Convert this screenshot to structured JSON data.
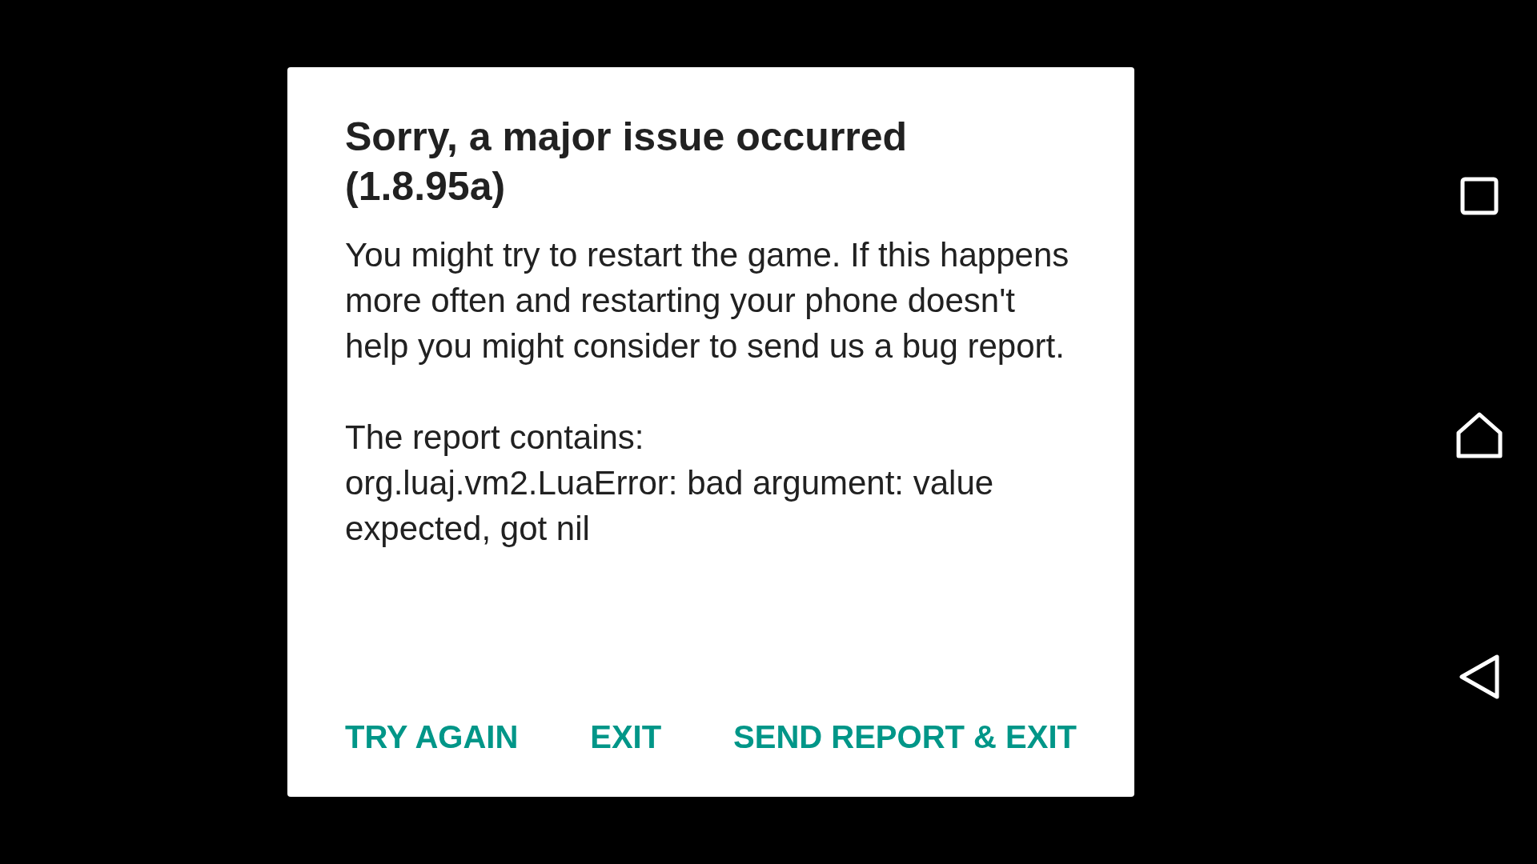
{
  "dialog": {
    "title": "Sorry, a major issue occurred (1.8.95a)",
    "paragraphs": [
      "You might try to restart the game. If this happens more often and restarting your phone doesn't help you might consider to send us a bug report.",
      "The report contains:\norg.luaj.vm2.LuaError: bad argument: value expected, got nil"
    ],
    "buttons": [
      "TRY AGAIN",
      "EXIT",
      "SEND REPORT & EXIT"
    ]
  },
  "nav_bar": [
    {
      "kind": "recents"
    },
    {
      "kind": "home"
    },
    {
      "kind": "back"
    }
  ]
}
